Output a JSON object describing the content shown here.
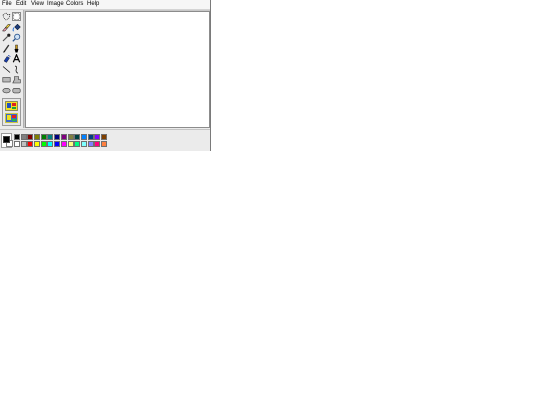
{
  "menu": {
    "items": [
      "File",
      "Edit",
      "View",
      "Image",
      "Colors",
      "Help"
    ]
  },
  "toolbox": {
    "tools": [
      {
        "icon": "free-form-select-icon"
      },
      {
        "icon": "select-icon"
      },
      {
        "icon": "eraser-icon"
      },
      {
        "icon": "fill-bucket-icon"
      },
      {
        "icon": "color-picker-icon"
      },
      {
        "icon": "magnifier-icon"
      },
      {
        "icon": "pencil-icon"
      },
      {
        "icon": "brush-icon"
      },
      {
        "icon": "airbrush-icon"
      },
      {
        "icon": "text-icon"
      },
      {
        "icon": "line-icon"
      },
      {
        "icon": "curve-icon"
      },
      {
        "icon": "rectangle-icon"
      },
      {
        "icon": "polygon-icon"
      },
      {
        "icon": "ellipse-icon"
      },
      {
        "icon": "rounded-rectangle-icon"
      }
    ],
    "selected_tool": "select-icon",
    "options": [
      {
        "icon": "opaque-selection-icon"
      },
      {
        "icon": "transparent-selection-icon"
      }
    ],
    "selected_option": 1
  },
  "colors": {
    "foreground": "#000000",
    "background": "#ffffff",
    "palette": [
      [
        "#000000",
        "#808080",
        "#800000",
        "#808000",
        "#008000",
        "#008080",
        "#000080",
        "#800080",
        "#808040",
        "#004040",
        "#0080ff",
        "#004080",
        "#8000ff",
        "#804000"
      ],
      [
        "#ffffff",
        "#c0c0c0",
        "#ff0000",
        "#ffff00",
        "#00ff00",
        "#00ffff",
        "#0000ff",
        "#ff00ff",
        "#ffff80",
        "#00ff80",
        "#80ffff",
        "#8080ff",
        "#ff0080",
        "#ff8040"
      ]
    ]
  }
}
